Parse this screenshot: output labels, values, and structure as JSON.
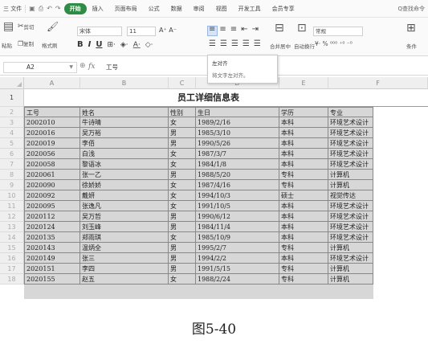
{
  "menu": {
    "file": "三 文件",
    "tabs": [
      {
        "label": "开始",
        "active": true
      },
      {
        "label": "插入",
        "active": false
      },
      {
        "label": "页面布局",
        "active": false
      },
      {
        "label": "公式",
        "active": false
      },
      {
        "label": "数据",
        "active": false
      },
      {
        "label": "审阅",
        "active": false
      },
      {
        "label": "视图",
        "active": false
      },
      {
        "label": "开发工具",
        "active": false
      },
      {
        "label": "会员专享",
        "active": false
      }
    ],
    "search": "Q查找命令"
  },
  "ribbon": {
    "cut": "剪切",
    "paste": "粘贴",
    "copy": "复制",
    "format_painter": "格式刷",
    "font_name": "宋体",
    "font_size": "11",
    "merge_center": "合并居中",
    "wrap_text": "自动换行",
    "number_format": "常规",
    "conditional": "条件",
    "bold": "B",
    "italic": "I",
    "underline": "U"
  },
  "tooltip": {
    "title": "左对齐",
    "desc": "将文字左对齐。"
  },
  "formula_bar": {
    "name_box": "A2",
    "fx": "fx",
    "content": "工号"
  },
  "grid": {
    "columns": [
      "A",
      "B",
      "C",
      "D",
      "E",
      "F"
    ],
    "row_numbers": [
      "1",
      "2",
      "3",
      "4",
      "5",
      "6",
      "7",
      "8",
      "9",
      "10",
      "11",
      "12",
      "13",
      "14",
      "15",
      "16",
      "17",
      "18"
    ],
    "title": "员工详细信息表",
    "header": [
      "工号",
      "姓名",
      "性别",
      "生日",
      "学历",
      "专业"
    ],
    "rows": [
      [
        "2002010",
        "牛诗晴",
        "女",
        "1989/2/16",
        "本科",
        "环境艺术设计"
      ],
      [
        "2020016",
        "吴万裕",
        "男",
        "1985/3/10",
        "本科",
        "环境艺术设计"
      ],
      [
        "2020019",
        "李佰",
        "男",
        "1990/5/26",
        "本科",
        "环境艺术设计"
      ],
      [
        "2020056",
        "白浅",
        "女",
        "1987/3/7",
        "本科",
        "环境艺术设计"
      ],
      [
        "2020058",
        "黎语冰",
        "女",
        "1984/1/8",
        "本科",
        "环境艺术设计"
      ],
      [
        "2020061",
        "张一乙",
        "男",
        "1988/5/20",
        "专科",
        "计算机"
      ],
      [
        "2020090",
        "徐娇娇",
        "女",
        "1987/4/16",
        "专科",
        "计算机"
      ],
      [
        "2020092",
        "戴妍",
        "女",
        "1994/10/3",
        "硕士",
        "视觉传达"
      ],
      [
        "2020095",
        "张逸凡",
        "女",
        "1991/10/5",
        "本科",
        "环境艺术设计"
      ],
      [
        "2020112",
        "吴万哲",
        "男",
        "1990/6/12",
        "本科",
        "环境艺术设计"
      ],
      [
        "2020124",
        "刘玉峰",
        "男",
        "1984/11/4",
        "本科",
        "环境艺术设计"
      ],
      [
        "2020135",
        "郑雨琪",
        "女",
        "1985/10/9",
        "本科",
        "环境艺术设计"
      ],
      [
        "2020143",
        "温炳全",
        "男",
        "1995/2/7",
        "专科",
        "计算机"
      ],
      [
        "2020149",
        "张三",
        "男",
        "1994/2/2",
        "本科",
        "环境艺术设计"
      ],
      [
        "2020151",
        "李四",
        "男",
        "1991/5/15",
        "专科",
        "计算机"
      ],
      [
        "2020155",
        "赵五",
        "女",
        "1988/2/24",
        "专科",
        "计算机"
      ]
    ]
  },
  "caption": "图5-40"
}
